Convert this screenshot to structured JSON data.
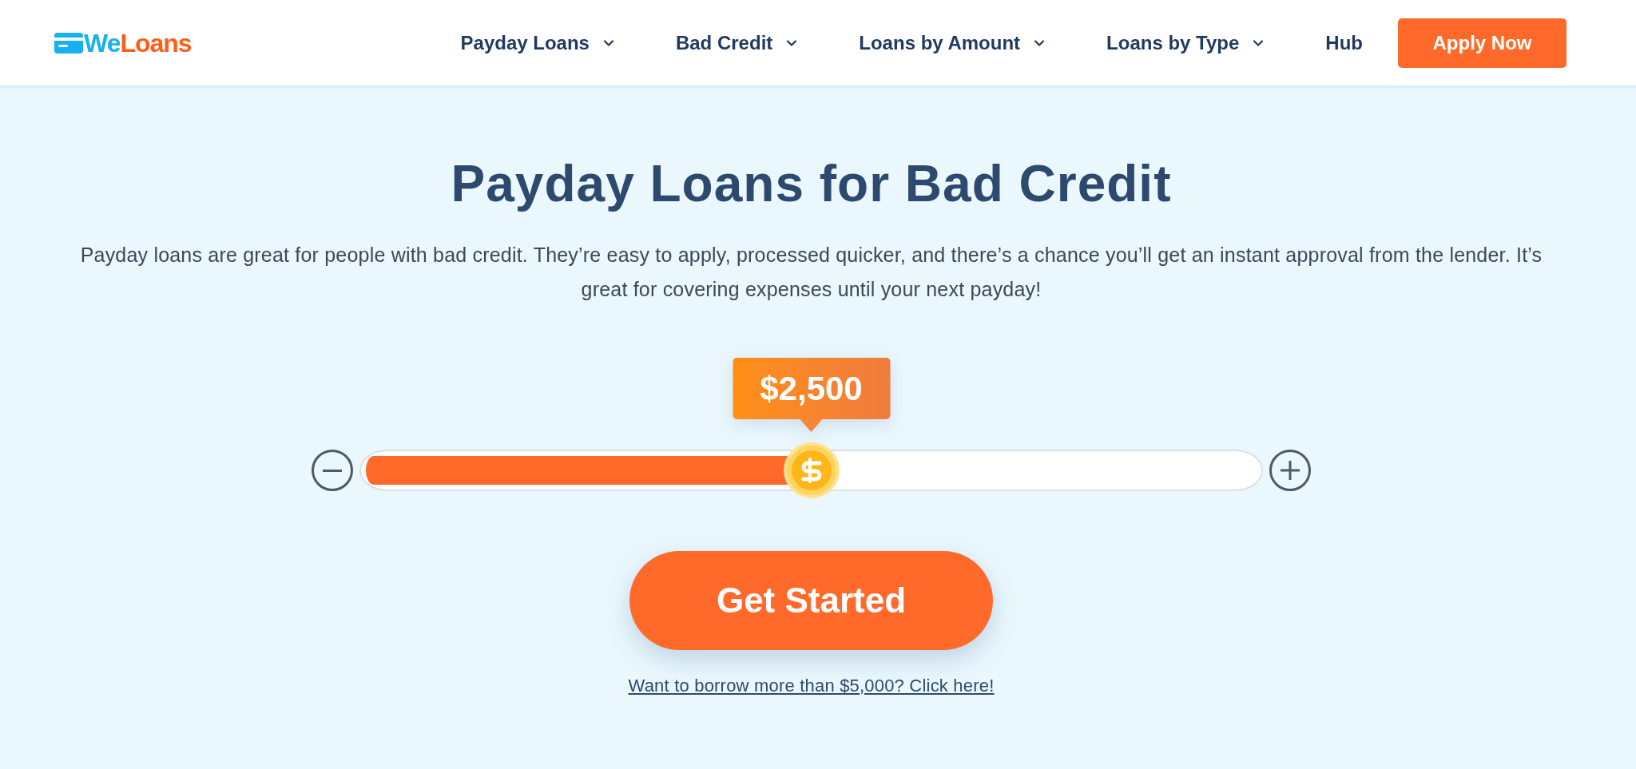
{
  "header": {
    "logo": {
      "segments": [
        {
          "text": "We",
          "color": "#17b1f0"
        },
        {
          "text": "Loans",
          "color": "#ff5d17"
        }
      ]
    },
    "nav": [
      {
        "label": "Payday Loans",
        "has_menu": true
      },
      {
        "label": "Bad Credit",
        "has_menu": true
      },
      {
        "label": "Loans by Amount",
        "has_menu": true
      },
      {
        "label": "Loans by Type",
        "has_menu": true
      },
      {
        "label": "Hub",
        "has_menu": false
      }
    ],
    "cta": "Apply Now"
  },
  "hero": {
    "title": "Payday Loans for Bad Credit",
    "description": "Payday loans are great for people with bad credit. They’re easy to apply, processed quicker, and there’s a chance you’ll get an instant approval from the lender. It’s great for covering expenses until your next payday!",
    "slider": {
      "level": 0.5,
      "reading": "$2,500"
    },
    "button": "Get Started",
    "link": "Want to borrow more than $5,000? Click here!"
  }
}
